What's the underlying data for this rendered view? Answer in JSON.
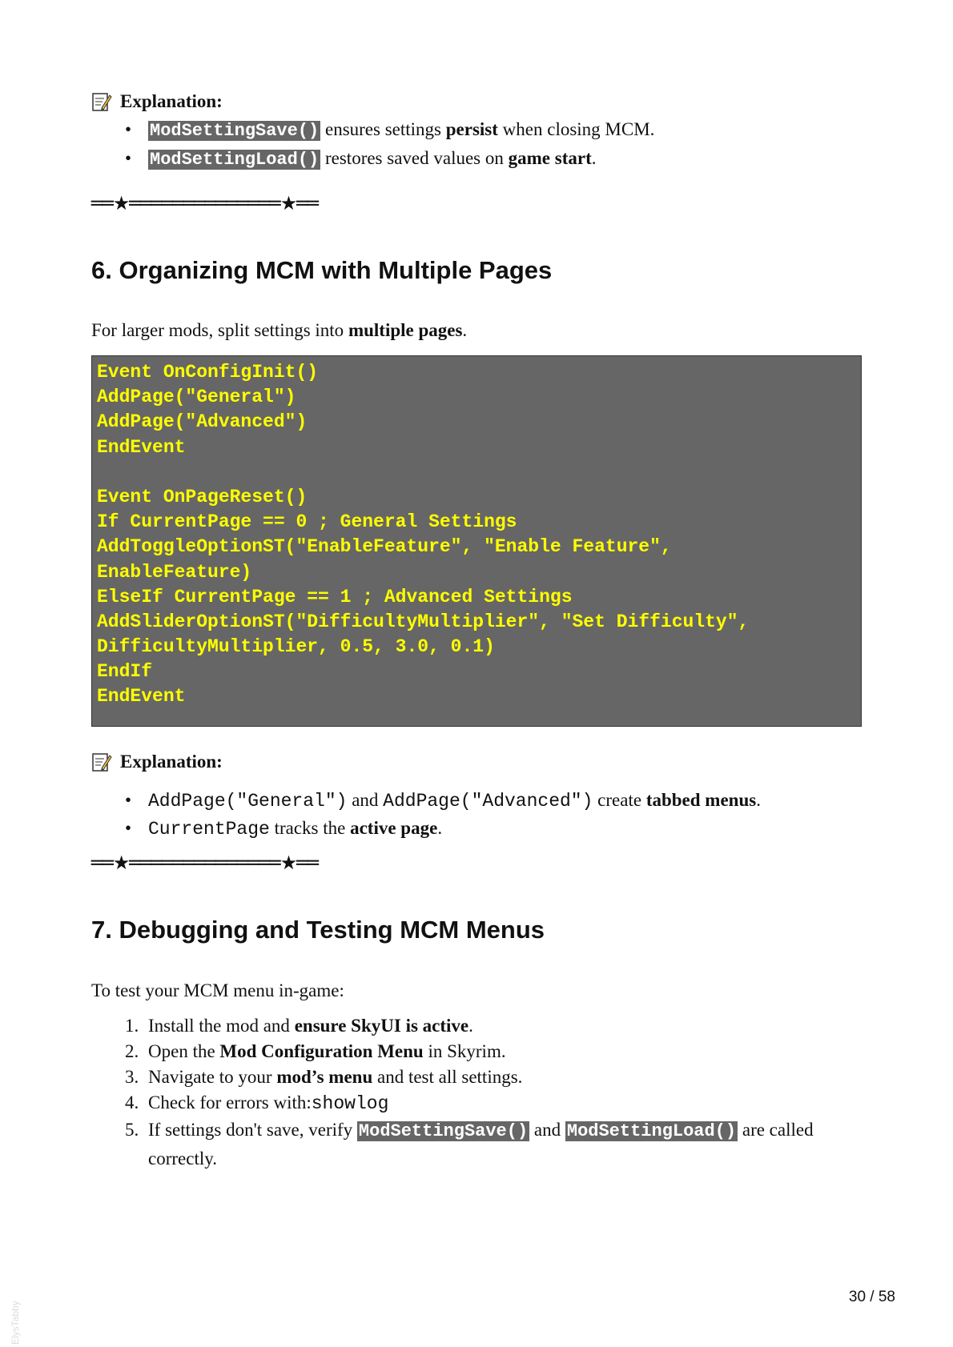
{
  "section5_tail": {
    "explanation_label": "Explanation:",
    "bullets": [
      {
        "code": "ModSettingSave()",
        "pre": " ensures settings ",
        "bold": "persist",
        "post": " when closing MCM."
      },
      {
        "code": "ModSettingLoad()",
        "pre": " restores saved values on ",
        "bold": "game start",
        "post": "."
      }
    ],
    "divider": "══★══════════════★══"
  },
  "section6": {
    "heading": "6. Organizing MCM with Multiple Pages",
    "intro_pre": "For larger mods, split settings into ",
    "intro_bold": "multiple pages",
    "intro_post": ".",
    "code_lines": [
      "Event OnConfigInit()",
      "AddPage(\"General\")",
      "AddPage(\"Advanced\")",
      "EndEvent",
      "",
      "Event OnPageReset()",
      "If CurrentPage == 0 ; General Settings",
      "AddToggleOptionST(\"EnableFeature\", \"Enable Feature\",",
      "EnableFeature)",
      "ElseIf CurrentPage == 1 ; Advanced Settings",
      "AddSliderOptionST(\"DifficultyMultiplier\", \"Set Difficulty\",",
      "DifficultyMultiplier, 0.5, 3.0, 0.1)",
      "EndIf",
      "EndEvent"
    ],
    "explanation_label": "Explanation:",
    "bullets": [
      {
        "code1": "AddPage(\"General\")",
        "mid": " and ",
        "code2": "AddPage(\"Advanced\")",
        "pre": " create ",
        "bold": "tabbed menus",
        "post": "."
      },
      {
        "code1": "CurrentPage",
        "pre": " tracks the ",
        "bold": "active page",
        "post": "."
      }
    ],
    "divider": "══★══════════════★══"
  },
  "section7": {
    "heading": "7. Debugging and Testing MCM Menus",
    "intro": "To test your MCM menu in-game:",
    "steps": [
      {
        "n": "1.",
        "pre": "Install the mod and ",
        "bold": "ensure SkyUI is active",
        "post": "."
      },
      {
        "n": "2.",
        "pre": "Open the ",
        "bold": "Mod Configuration Menu",
        "post": " in Skyrim."
      },
      {
        "n": "3.",
        "pre": "Navigate to your ",
        "bold": "mod’s menu",
        "post": " and test all settings."
      },
      {
        "n": "4.",
        "pre": "Check for errors with:",
        "code": "showlog"
      },
      {
        "n": "5.",
        "pre": "If settings don't save, verify ",
        "chip1": "ModSettingSave()",
        "mid": " and ",
        "chip2": "ModSettingLoad()",
        "post": " are called correctly."
      }
    ]
  },
  "footer": {
    "page_number": "30 / 58",
    "watermark": "ElysTabby"
  },
  "bullet_glyph": "•"
}
